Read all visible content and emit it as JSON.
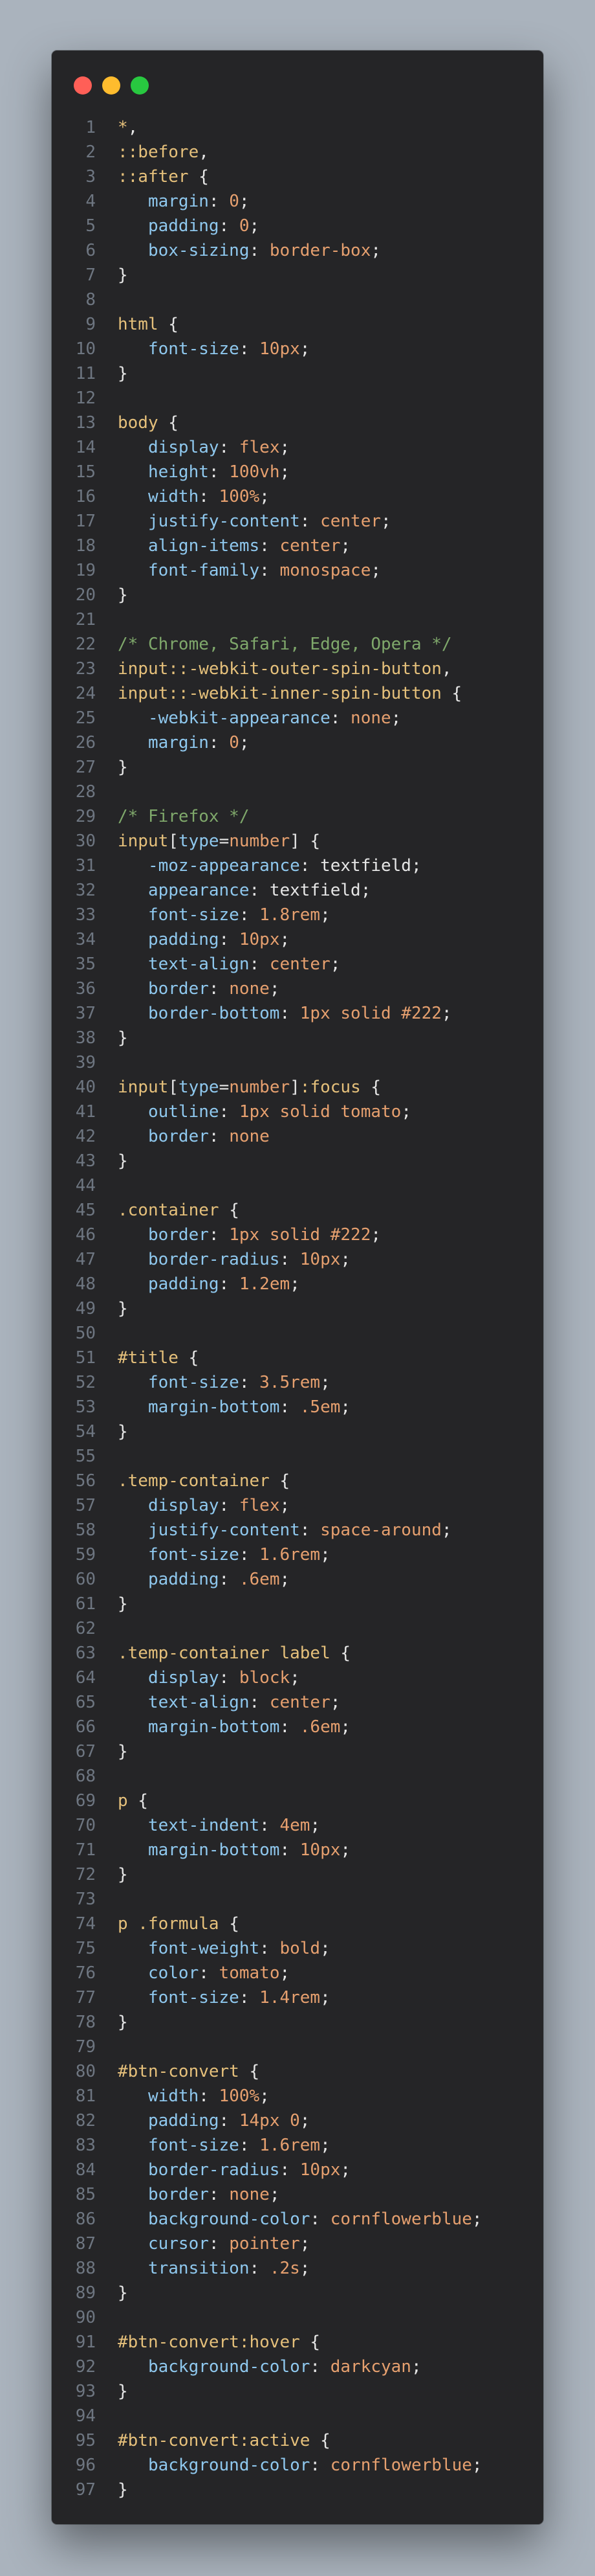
{
  "window": {
    "controls": [
      {
        "name": "close",
        "color": "#ff5f57"
      },
      {
        "name": "minimize",
        "color": "#febc2e"
      },
      {
        "name": "maximize",
        "color": "#28c840"
      }
    ]
  },
  "lines": [
    {
      "n": "1",
      "t": [
        [
          "*",
          "sel"
        ],
        [
          ",",
          "pun"
        ]
      ]
    },
    {
      "n": "2",
      "t": [
        [
          "::before",
          "sel"
        ],
        [
          ",",
          "pun"
        ]
      ]
    },
    {
      "n": "3",
      "t": [
        [
          "::after",
          "sel"
        ],
        [
          " {",
          "pun"
        ]
      ]
    },
    {
      "n": "4",
      "t": [
        [
          "   margin",
          "prop"
        ],
        [
          ": ",
          "pun"
        ],
        [
          "0",
          "val"
        ],
        [
          ";",
          "pun"
        ]
      ]
    },
    {
      "n": "5",
      "t": [
        [
          "   padding",
          "prop"
        ],
        [
          ": ",
          "pun"
        ],
        [
          "0",
          "val"
        ],
        [
          ";",
          "pun"
        ]
      ]
    },
    {
      "n": "6",
      "t": [
        [
          "   box-sizing",
          "prop"
        ],
        [
          ": ",
          "pun"
        ],
        [
          "border-box",
          "val"
        ],
        [
          ";",
          "pun"
        ]
      ]
    },
    {
      "n": "7",
      "t": [
        [
          "}",
          "pun"
        ]
      ]
    },
    {
      "n": "8",
      "t": []
    },
    {
      "n": "9",
      "t": [
        [
          "html",
          "sel"
        ],
        [
          " {",
          "pun"
        ]
      ]
    },
    {
      "n": "10",
      "t": [
        [
          "   font-size",
          "prop"
        ],
        [
          ": ",
          "pun"
        ],
        [
          "10px",
          "val"
        ],
        [
          ";",
          "pun"
        ]
      ]
    },
    {
      "n": "11",
      "t": [
        [
          "}",
          "pun"
        ]
      ]
    },
    {
      "n": "12",
      "t": []
    },
    {
      "n": "13",
      "t": [
        [
          "body",
          "sel"
        ],
        [
          " {",
          "pun"
        ]
      ]
    },
    {
      "n": "14",
      "t": [
        [
          "   display",
          "prop"
        ],
        [
          ": ",
          "pun"
        ],
        [
          "flex",
          "val"
        ],
        [
          ";",
          "pun"
        ]
      ]
    },
    {
      "n": "15",
      "t": [
        [
          "   height",
          "prop"
        ],
        [
          ": ",
          "pun"
        ],
        [
          "100vh",
          "val"
        ],
        [
          ";",
          "pun"
        ]
      ]
    },
    {
      "n": "16",
      "t": [
        [
          "   width",
          "prop"
        ],
        [
          ": ",
          "pun"
        ],
        [
          "100%",
          "val"
        ],
        [
          ";",
          "pun"
        ]
      ]
    },
    {
      "n": "17",
      "t": [
        [
          "   justify-content",
          "prop"
        ],
        [
          ": ",
          "pun"
        ],
        [
          "center",
          "val"
        ],
        [
          ";",
          "pun"
        ]
      ]
    },
    {
      "n": "18",
      "t": [
        [
          "   align-items",
          "prop"
        ],
        [
          ": ",
          "pun"
        ],
        [
          "center",
          "val"
        ],
        [
          ";",
          "pun"
        ]
      ]
    },
    {
      "n": "19",
      "t": [
        [
          "   font-family",
          "prop"
        ],
        [
          ": ",
          "pun"
        ],
        [
          "monospace",
          "val"
        ],
        [
          ";",
          "pun"
        ]
      ]
    },
    {
      "n": "20",
      "t": [
        [
          "}",
          "pun"
        ]
      ]
    },
    {
      "n": "21",
      "t": []
    },
    {
      "n": "22",
      "t": [
        [
          "/* Chrome, Safari, Edge, Opera */",
          "com"
        ]
      ]
    },
    {
      "n": "23",
      "t": [
        [
          "input::-webkit-outer-spin-button",
          "sel"
        ],
        [
          ",",
          "pun"
        ]
      ]
    },
    {
      "n": "24",
      "t": [
        [
          "input::-webkit-inner-spin-button",
          "sel"
        ],
        [
          " {",
          "pun"
        ]
      ]
    },
    {
      "n": "25",
      "t": [
        [
          "   -webkit-appearance",
          "prop"
        ],
        [
          ": ",
          "pun"
        ],
        [
          "none",
          "val"
        ],
        [
          ";",
          "pun"
        ]
      ]
    },
    {
      "n": "26",
      "t": [
        [
          "   margin",
          "prop"
        ],
        [
          ": ",
          "pun"
        ],
        [
          "0",
          "val"
        ],
        [
          ";",
          "pun"
        ]
      ]
    },
    {
      "n": "27",
      "t": [
        [
          "}",
          "pun"
        ]
      ]
    },
    {
      "n": "28",
      "t": []
    },
    {
      "n": "29",
      "t": [
        [
          "/* Firefox */",
          "com"
        ]
      ]
    },
    {
      "n": "30",
      "t": [
        [
          "input",
          "sel"
        ],
        [
          "[",
          "pun"
        ],
        [
          "type",
          "prop"
        ],
        [
          "=",
          "pun"
        ],
        [
          "number",
          "val"
        ],
        [
          "]",
          "pun"
        ],
        [
          " {",
          "pun"
        ]
      ]
    },
    {
      "n": "31",
      "t": [
        [
          "   -moz-appearance",
          "prop"
        ],
        [
          ": ",
          "pun"
        ],
        [
          "textfield",
          "plain"
        ],
        [
          ";",
          "pun"
        ]
      ]
    },
    {
      "n": "32",
      "t": [
        [
          "   appearance",
          "prop"
        ],
        [
          ": ",
          "pun"
        ],
        [
          "textfield",
          "plain"
        ],
        [
          ";",
          "pun"
        ]
      ]
    },
    {
      "n": "33",
      "t": [
        [
          "   font-size",
          "prop"
        ],
        [
          ": ",
          "pun"
        ],
        [
          "1.8rem",
          "val"
        ],
        [
          ";",
          "pun"
        ]
      ]
    },
    {
      "n": "34",
      "t": [
        [
          "   padding",
          "prop"
        ],
        [
          ": ",
          "pun"
        ],
        [
          "10px",
          "val"
        ],
        [
          ";",
          "pun"
        ]
      ]
    },
    {
      "n": "35",
      "t": [
        [
          "   text-align",
          "prop"
        ],
        [
          ": ",
          "pun"
        ],
        [
          "center",
          "val"
        ],
        [
          ";",
          "pun"
        ]
      ]
    },
    {
      "n": "36",
      "t": [
        [
          "   border",
          "prop"
        ],
        [
          ": ",
          "pun"
        ],
        [
          "none",
          "val"
        ],
        [
          ";",
          "pun"
        ]
      ]
    },
    {
      "n": "37",
      "t": [
        [
          "   border-bottom",
          "prop"
        ],
        [
          ": ",
          "pun"
        ],
        [
          "1px solid #222",
          "val"
        ],
        [
          ";",
          "pun"
        ]
      ]
    },
    {
      "n": "38",
      "t": [
        [
          "}",
          "pun"
        ]
      ]
    },
    {
      "n": "39",
      "t": []
    },
    {
      "n": "40",
      "t": [
        [
          "input",
          "sel"
        ],
        [
          "[",
          "pun"
        ],
        [
          "type",
          "prop"
        ],
        [
          "=",
          "pun"
        ],
        [
          "number",
          "val"
        ],
        [
          "]",
          "pun"
        ],
        [
          ":focus",
          "sel"
        ],
        [
          " {",
          "pun"
        ]
      ]
    },
    {
      "n": "41",
      "t": [
        [
          "   outline",
          "prop"
        ],
        [
          ": ",
          "pun"
        ],
        [
          "1px solid tomato",
          "val"
        ],
        [
          ";",
          "pun"
        ]
      ]
    },
    {
      "n": "42",
      "t": [
        [
          "   border",
          "prop"
        ],
        [
          ": ",
          "pun"
        ],
        [
          "none",
          "val"
        ]
      ]
    },
    {
      "n": "43",
      "t": [
        [
          "}",
          "pun"
        ]
      ]
    },
    {
      "n": "44",
      "t": []
    },
    {
      "n": "45",
      "t": [
        [
          ".container",
          "sel"
        ],
        [
          " {",
          "pun"
        ]
      ]
    },
    {
      "n": "46",
      "t": [
        [
          "   border",
          "prop"
        ],
        [
          ": ",
          "pun"
        ],
        [
          "1px solid #222",
          "val"
        ],
        [
          ";",
          "pun"
        ]
      ]
    },
    {
      "n": "47",
      "t": [
        [
          "   border-radius",
          "prop"
        ],
        [
          ": ",
          "pun"
        ],
        [
          "10px",
          "val"
        ],
        [
          ";",
          "pun"
        ]
      ]
    },
    {
      "n": "48",
      "t": [
        [
          "   padding",
          "prop"
        ],
        [
          ": ",
          "pun"
        ],
        [
          "1.2em",
          "val"
        ],
        [
          ";",
          "pun"
        ]
      ]
    },
    {
      "n": "49",
      "t": [
        [
          "}",
          "pun"
        ]
      ]
    },
    {
      "n": "50",
      "t": []
    },
    {
      "n": "51",
      "t": [
        [
          "#title",
          "sel"
        ],
        [
          " {",
          "pun"
        ]
      ]
    },
    {
      "n": "52",
      "t": [
        [
          "   font-size",
          "prop"
        ],
        [
          ": ",
          "pun"
        ],
        [
          "3.5rem",
          "val"
        ],
        [
          ";",
          "pun"
        ]
      ]
    },
    {
      "n": "53",
      "t": [
        [
          "   margin-bottom",
          "prop"
        ],
        [
          ": ",
          "pun"
        ],
        [
          ".5em",
          "val"
        ],
        [
          ";",
          "pun"
        ]
      ]
    },
    {
      "n": "54",
      "t": [
        [
          "}",
          "pun"
        ]
      ]
    },
    {
      "n": "55",
      "t": []
    },
    {
      "n": "56",
      "t": [
        [
          ".temp-container",
          "sel"
        ],
        [
          " {",
          "pun"
        ]
      ]
    },
    {
      "n": "57",
      "t": [
        [
          "   display",
          "prop"
        ],
        [
          ": ",
          "pun"
        ],
        [
          "flex",
          "val"
        ],
        [
          ";",
          "pun"
        ]
      ]
    },
    {
      "n": "58",
      "t": [
        [
          "   justify-content",
          "prop"
        ],
        [
          ": ",
          "pun"
        ],
        [
          "space-around",
          "val"
        ],
        [
          ";",
          "pun"
        ]
      ]
    },
    {
      "n": "59",
      "t": [
        [
          "   font-size",
          "prop"
        ],
        [
          ": ",
          "pun"
        ],
        [
          "1.6rem",
          "val"
        ],
        [
          ";",
          "pun"
        ]
      ]
    },
    {
      "n": "60",
      "t": [
        [
          "   padding",
          "prop"
        ],
        [
          ": ",
          "pun"
        ],
        [
          ".6em",
          "val"
        ],
        [
          ";",
          "pun"
        ]
      ]
    },
    {
      "n": "61",
      "t": [
        [
          "}",
          "pun"
        ]
      ]
    },
    {
      "n": "62",
      "t": []
    },
    {
      "n": "63",
      "t": [
        [
          ".temp-container label",
          "sel"
        ],
        [
          " {",
          "pun"
        ]
      ]
    },
    {
      "n": "64",
      "t": [
        [
          "   display",
          "prop"
        ],
        [
          ": ",
          "pun"
        ],
        [
          "block",
          "val"
        ],
        [
          ";",
          "pun"
        ]
      ]
    },
    {
      "n": "65",
      "t": [
        [
          "   text-align",
          "prop"
        ],
        [
          ": ",
          "pun"
        ],
        [
          "center",
          "val"
        ],
        [
          ";",
          "pun"
        ]
      ]
    },
    {
      "n": "66",
      "t": [
        [
          "   margin-bottom",
          "prop"
        ],
        [
          ": ",
          "pun"
        ],
        [
          ".6em",
          "val"
        ],
        [
          ";",
          "pun"
        ]
      ]
    },
    {
      "n": "67",
      "t": [
        [
          "}",
          "pun"
        ]
      ]
    },
    {
      "n": "68",
      "t": []
    },
    {
      "n": "69",
      "t": [
        [
          "p",
          "sel"
        ],
        [
          " {",
          "pun"
        ]
      ]
    },
    {
      "n": "70",
      "t": [
        [
          "   text-indent",
          "prop"
        ],
        [
          ": ",
          "pun"
        ],
        [
          "4em",
          "val"
        ],
        [
          ";",
          "pun"
        ]
      ]
    },
    {
      "n": "71",
      "t": [
        [
          "   margin-bottom",
          "prop"
        ],
        [
          ": ",
          "pun"
        ],
        [
          "10px",
          "val"
        ],
        [
          ";",
          "pun"
        ]
      ]
    },
    {
      "n": "72",
      "t": [
        [
          "}",
          "pun"
        ]
      ]
    },
    {
      "n": "73",
      "t": []
    },
    {
      "n": "74",
      "t": [
        [
          "p .formula",
          "sel"
        ],
        [
          " {",
          "pun"
        ]
      ]
    },
    {
      "n": "75",
      "t": [
        [
          "   font-weight",
          "prop"
        ],
        [
          ": ",
          "pun"
        ],
        [
          "bold",
          "val"
        ],
        [
          ";",
          "pun"
        ]
      ]
    },
    {
      "n": "76",
      "t": [
        [
          "   color",
          "prop"
        ],
        [
          ": ",
          "pun"
        ],
        [
          "tomato",
          "val"
        ],
        [
          ";",
          "pun"
        ]
      ]
    },
    {
      "n": "77",
      "t": [
        [
          "   font-size",
          "prop"
        ],
        [
          ": ",
          "pun"
        ],
        [
          "1.4rem",
          "val"
        ],
        [
          ";",
          "pun"
        ]
      ]
    },
    {
      "n": "78",
      "t": [
        [
          "}",
          "pun"
        ]
      ]
    },
    {
      "n": "79",
      "t": []
    },
    {
      "n": "80",
      "t": [
        [
          "#btn-convert",
          "sel"
        ],
        [
          " {",
          "pun"
        ]
      ]
    },
    {
      "n": "81",
      "t": [
        [
          "   width",
          "prop"
        ],
        [
          ": ",
          "pun"
        ],
        [
          "100%",
          "val"
        ],
        [
          ";",
          "pun"
        ]
      ]
    },
    {
      "n": "82",
      "t": [
        [
          "   padding",
          "prop"
        ],
        [
          ": ",
          "pun"
        ],
        [
          "14px 0",
          "val"
        ],
        [
          ";",
          "pun"
        ]
      ]
    },
    {
      "n": "83",
      "t": [
        [
          "   font-size",
          "prop"
        ],
        [
          ": ",
          "pun"
        ],
        [
          "1.6rem",
          "val"
        ],
        [
          ";",
          "pun"
        ]
      ]
    },
    {
      "n": "84",
      "t": [
        [
          "   border-radius",
          "prop"
        ],
        [
          ": ",
          "pun"
        ],
        [
          "10px",
          "val"
        ],
        [
          ";",
          "pun"
        ]
      ]
    },
    {
      "n": "85",
      "t": [
        [
          "   border",
          "prop"
        ],
        [
          ": ",
          "pun"
        ],
        [
          "none",
          "val"
        ],
        [
          ";",
          "pun"
        ]
      ]
    },
    {
      "n": "86",
      "t": [
        [
          "   background-color",
          "prop"
        ],
        [
          ": ",
          "pun"
        ],
        [
          "cornflowerblue",
          "val"
        ],
        [
          ";",
          "pun"
        ]
      ]
    },
    {
      "n": "87",
      "t": [
        [
          "   cursor",
          "prop"
        ],
        [
          ": ",
          "pun"
        ],
        [
          "pointer",
          "val"
        ],
        [
          ";",
          "pun"
        ]
      ]
    },
    {
      "n": "88",
      "t": [
        [
          "   transition",
          "prop"
        ],
        [
          ": ",
          "pun"
        ],
        [
          ".2s",
          "val"
        ],
        [
          ";",
          "pun"
        ]
      ]
    },
    {
      "n": "89",
      "t": [
        [
          "}",
          "pun"
        ]
      ]
    },
    {
      "n": "90",
      "t": []
    },
    {
      "n": "91",
      "t": [
        [
          "#btn-convert:hover",
          "sel"
        ],
        [
          " {",
          "pun"
        ]
      ]
    },
    {
      "n": "92",
      "t": [
        [
          "   background-color",
          "prop"
        ],
        [
          ": ",
          "pun"
        ],
        [
          "darkcyan",
          "val"
        ],
        [
          ";",
          "pun"
        ]
      ]
    },
    {
      "n": "93",
      "t": [
        [
          "}",
          "pun"
        ]
      ]
    },
    {
      "n": "94",
      "t": []
    },
    {
      "n": "95",
      "t": [
        [
          "#btn-convert:active",
          "sel"
        ],
        [
          " {",
          "pun"
        ]
      ]
    },
    {
      "n": "96",
      "t": [
        [
          "   background-color",
          "prop"
        ],
        [
          ": ",
          "pun"
        ],
        [
          "cornflowerblue",
          "val"
        ],
        [
          ";",
          "pun"
        ]
      ]
    },
    {
      "n": "97",
      "t": [
        [
          "}",
          "pun"
        ]
      ]
    }
  ]
}
